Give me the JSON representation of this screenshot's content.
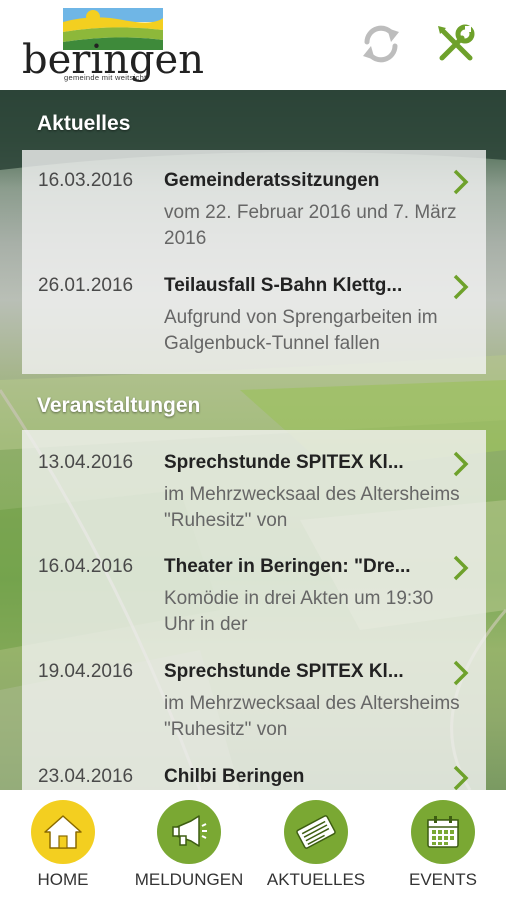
{
  "app": {
    "logo_name": "beringen",
    "logo_tagline": "gemeinde mit weitsicht"
  },
  "header": {
    "refresh_icon": "refresh-icon",
    "settings_icon": "tools-icon"
  },
  "colors": {
    "accent_green": "#7aa833",
    "active_yellow": "#f3cf20"
  },
  "news": {
    "title": "Aktuelles",
    "items": [
      {
        "date": "16.03.2016",
        "title": "Gemeinderatssitzungen",
        "desc": "vom 22. Februar 2016 und 7. März 2016"
      },
      {
        "date": "26.01.2016",
        "title": "Teilausfall S-Bahn Klettg...",
        "desc": "Aufgrund von Sprengarbeiten im Galgenbuck-Tunnel fallen"
      }
    ]
  },
  "events": {
    "title": "Veranstaltungen",
    "items": [
      {
        "date": "13.04.2016",
        "title": "Sprechstunde SPITEX Kl...",
        "desc": "im Mehrzwecksaal des Altersheims \"Ruhesitz\" von"
      },
      {
        "date": "16.04.2016",
        "title": "Theater in Beringen: \"Dre...",
        "desc": "Komödie in drei Akten um 19:30 Uhr in der"
      },
      {
        "date": "19.04.2016",
        "title": "Sprechstunde SPITEX Kl...",
        "desc": "im Mehrzwecksaal des Altersheims \"Ruhesitz\" von"
      },
      {
        "date": "23.04.2016",
        "title": "Chilbi Beringen",
        "desc": ""
      }
    ]
  },
  "nav": {
    "items": [
      {
        "label": "HOME",
        "icon": "home-icon",
        "active": true
      },
      {
        "label": "MELDUNGEN",
        "icon": "megaphone-icon",
        "active": false
      },
      {
        "label": "AKTUELLES",
        "icon": "newspaper-icon",
        "active": false
      },
      {
        "label": "EVENTS",
        "icon": "calendar-icon",
        "active": false
      }
    ]
  }
}
